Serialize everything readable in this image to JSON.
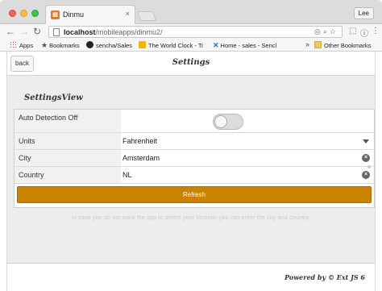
{
  "browser": {
    "tab_title": "Dinmu",
    "tab_close": "×",
    "user": "Lee",
    "url_host": "localhost",
    "url_path": "/mobileapps/dinmu2/",
    "bookmarks": [
      {
        "label": "Apps"
      },
      {
        "label": "Bookmarks"
      },
      {
        "label": "sencha/Sales"
      },
      {
        "label": "The World Clock - Ti"
      },
      {
        "label": "Home - sales - Sencl"
      }
    ],
    "bookmarks_overflow": "»",
    "other_bookmarks": "Other Bookmarks"
  },
  "app": {
    "back_label": "back",
    "title": "Settings",
    "view_title": "SettingsView",
    "form": {
      "auto_detection": {
        "label": "Auto Detection Off",
        "value": false
      },
      "units": {
        "label": "Units",
        "value": "Fahrenheit"
      },
      "city": {
        "label": "City",
        "value": "Amsterdam"
      },
      "country": {
        "label": "Country",
        "value": "NL"
      }
    },
    "refresh_label": "Refresh",
    "help_text": "In case you do not want the app to detect your location you can enter the city and country.",
    "footer": "Powered by © Ext JS 6"
  }
}
